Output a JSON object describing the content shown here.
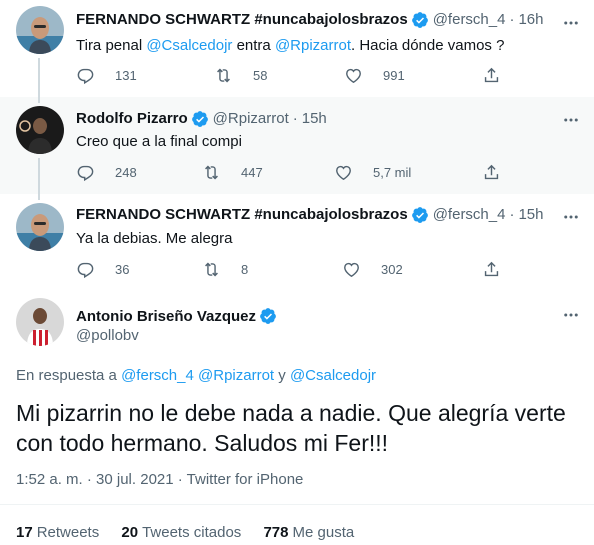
{
  "colors": {
    "accent": "#1d9bf0",
    "secondary_text": "#536471",
    "primary_text": "#0f1419",
    "highlight_bg": "#f7f9f9"
  },
  "tweets": [
    {
      "name": "FERNANDO SCHWARTZ #nuncabajolosbrazos",
      "handle": "@fersch_4",
      "time": "16h",
      "text_parts": [
        "Tira penal ",
        "@Csalcedojr",
        " entra ",
        "@Rpizarrot",
        ". Hacia dónde vamos ?"
      ],
      "replies": "131",
      "retweets": "58",
      "likes": "991"
    },
    {
      "name": "Rodolfo Pizarro",
      "handle": "@Rpizarrot",
      "time": "15h",
      "text": "Creo que a la final compi",
      "replies": "248",
      "retweets": "447",
      "likes": "5,7 mil"
    },
    {
      "name": "FERNANDO SCHWARTZ #nuncabajolosbrazos",
      "handle": "@fersch_4",
      "time": "15h",
      "text": "Ya la debias. Me alegra",
      "replies": "36",
      "retweets": "8",
      "likes": "302"
    }
  ],
  "main_tweet": {
    "name": "Antonio Briseño Vazquez",
    "handle": "@pollobv",
    "reply_prefix": "En respuesta a ",
    "reply_mentions": [
      "@fersch_4",
      "@Rpizarrot",
      "@Csalcedojr"
    ],
    "reply_joiner": " y ",
    "text": "Mi pizarrin no le debe nada a nadie. Que alegría verte con todo hermano. Saludos mi Fer!!!",
    "timestamp": "1:52 a. m. · 30 jul. 2021 · Twitter for iPhone",
    "retweets_count": "17",
    "retweets_label": "Retweets",
    "quotes_count": "20",
    "quotes_label": "Tweets citados",
    "likes_count": "778",
    "likes_label": "Me gusta"
  }
}
